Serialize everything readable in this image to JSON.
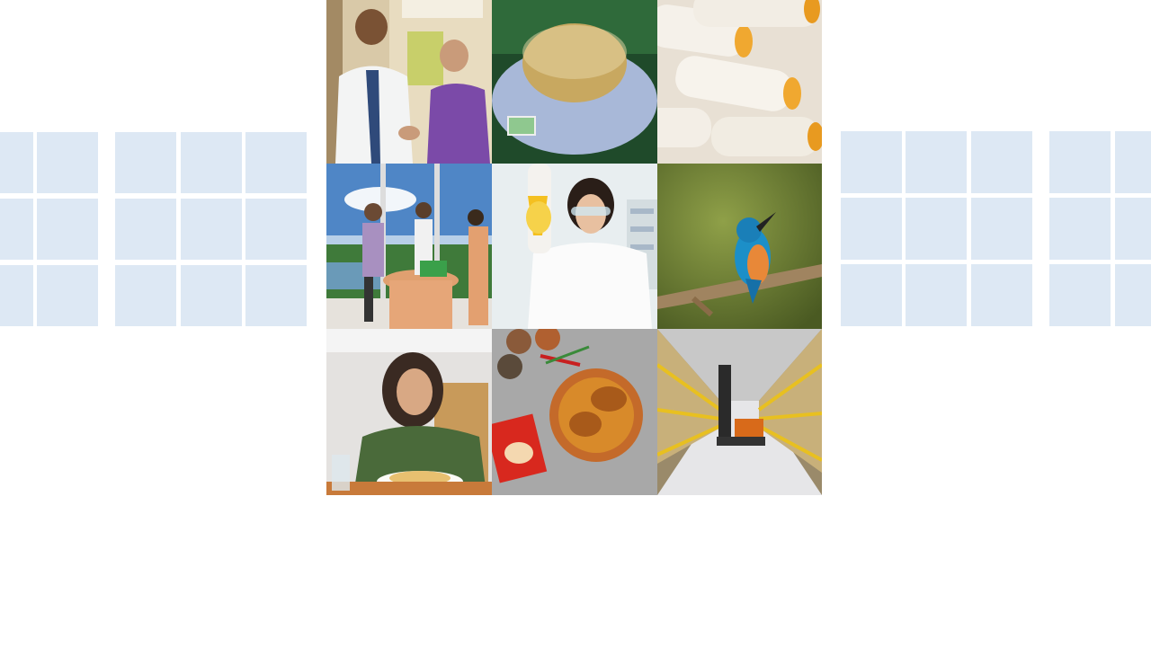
{
  "colors": {
    "square_fill": "#dde8f4",
    "background": "#ffffff"
  },
  "collage": {
    "tiles": [
      {
        "icon": "doctor-patient-photo"
      },
      {
        "icon": "tea-cup-photo"
      },
      {
        "icon": "yarn-spools-photo"
      },
      {
        "icon": "office-meeting-photo"
      },
      {
        "icon": "lab-scientist-photo"
      },
      {
        "icon": "kingfisher-bird-photo"
      },
      {
        "icon": "woman-eating-photo"
      },
      {
        "icon": "fish-curry-spices-photo"
      },
      {
        "icon": "warehouse-forklift-photo"
      }
    ]
  }
}
